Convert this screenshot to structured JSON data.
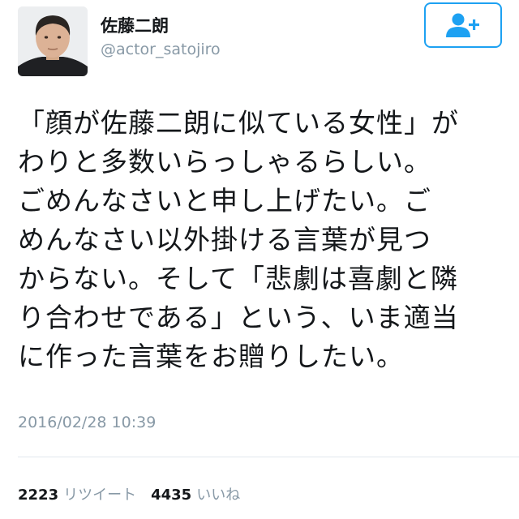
{
  "user": {
    "display_name": "佐藤二朗",
    "handle": "@actor_satojiro"
  },
  "follow_button": {
    "icon": "add-user-icon",
    "color": "#1da1f2"
  },
  "tweet": {
    "lines": [
      "「顔が佐藤二朗に似ている女性」が",
      "わりと多数いらっしゃるらしい。",
      "ごめんなさいと申し上げたい。ご",
      "めんなさい以外掛ける言葉が見つ",
      "からない。そして「悲劇は喜劇と隣",
      "り合わせである」という、いま適当",
      "に作った言葉をお贈りしたい。"
    ],
    "timestamp": "2016/02/28 10:39"
  },
  "stats": {
    "retweet_count": "2223",
    "retweet_label": "リツイート",
    "like_count": "4435",
    "like_label": "いいね"
  },
  "colors": {
    "text": "#14171a",
    "secondary": "#8899a6",
    "accent": "#1da1f2",
    "divider": "#e1e8ed"
  }
}
